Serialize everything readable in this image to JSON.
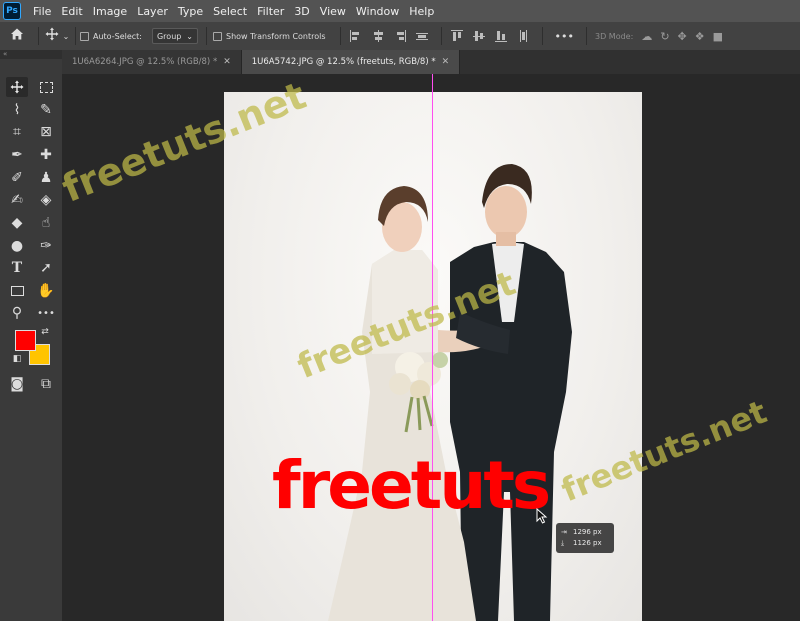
{
  "app": {
    "logo": "Ps"
  },
  "menu": [
    "File",
    "Edit",
    "Image",
    "Layer",
    "Type",
    "Select",
    "Filter",
    "3D",
    "View",
    "Window",
    "Help"
  ],
  "options_bar": {
    "auto_select_label": "Auto-Select:",
    "auto_select_value": "Group",
    "show_transform_label": "Show Transform Controls",
    "more_label": "•••",
    "mode_3d_label": "3D Mode:"
  },
  "tabs": [
    {
      "label": "1U6A6264.JPG @ 12.5% (RGB/8) *",
      "active": false
    },
    {
      "label": "1U6A5742.JPG @ 12.5% (freetuts, RGB/8) *",
      "active": true
    }
  ],
  "canvas": {
    "text_layer": "freetuts",
    "text_color": "#ff0000",
    "guide_color": "#ff4df0",
    "measure": {
      "width": "1296 px",
      "height": "1126 px"
    }
  },
  "colors": {
    "foreground": "#ff0000",
    "background": "#ffc400"
  },
  "watermark": "freetuts.net",
  "toolbar": {
    "tools": [
      "move-tool",
      "marquee-tool",
      "lasso-tool",
      "quick-select-tool",
      "crop-tool",
      "frame-tool",
      "eyedropper-tool",
      "healing-tool",
      "brush-tool",
      "stamp-tool",
      "history-brush-tool",
      "eraser-tool",
      "paint-bucket-tool",
      "smudge-tool",
      "dodge-tool",
      "pen-tool",
      "type-tool",
      "path-select-tool",
      "rectangle-tool",
      "hand-tool",
      "zoom-tool",
      "more-tools",
      "quick-mask",
      "screen-mode"
    ]
  }
}
